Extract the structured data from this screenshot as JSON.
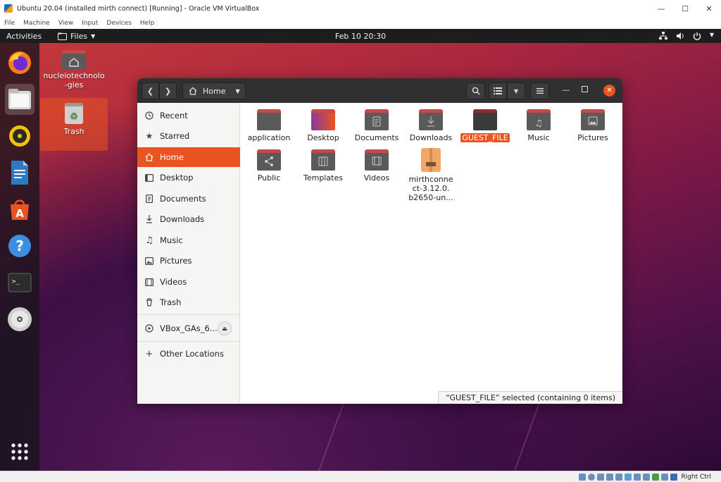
{
  "vbox": {
    "title": "Ubuntu 20.04 (installed mirth connect) [Running] - Oracle VM VirtualBox",
    "menu": [
      "File",
      "Machine",
      "View",
      "Input",
      "Devices",
      "Help"
    ],
    "host_key": "Right Ctrl"
  },
  "topbar": {
    "activities": "Activities",
    "app": "Files",
    "clock": "Feb 10  20:30"
  },
  "desktop": {
    "icons": [
      {
        "label": "nucleiotechnolo-gies",
        "icon": "home-folder-icon"
      },
      {
        "label": "Trash",
        "icon": "trash-icon"
      }
    ]
  },
  "dock": {
    "items": [
      "firefox-icon",
      "files-icon",
      "rhythmbox-icon",
      "libreoffice-writer-icon",
      "ubuntu-software-icon",
      "help-icon",
      "terminal-icon",
      "optical-disc-icon",
      "show-applications-icon"
    ]
  },
  "nautilus": {
    "path_label": "Home",
    "sidebar": [
      {
        "label": "Recent",
        "icon": "clock-icon"
      },
      {
        "label": "Starred",
        "icon": "star-icon"
      },
      {
        "label": "Home",
        "icon": "home-icon"
      },
      {
        "label": "Desktop",
        "icon": "desktop-icon"
      },
      {
        "label": "Documents",
        "icon": "document-icon"
      },
      {
        "label": "Downloads",
        "icon": "download-icon"
      },
      {
        "label": "Music",
        "icon": "music-icon"
      },
      {
        "label": "Pictures",
        "icon": "picture-icon"
      },
      {
        "label": "Videos",
        "icon": "video-icon"
      },
      {
        "label": "Trash",
        "icon": "trash-icon"
      },
      {
        "label": "VBox_GAs_6....",
        "icon": "disc-icon"
      },
      {
        "label": "Other Locations",
        "icon": "plus-icon"
      }
    ],
    "files": [
      {
        "label": "application",
        "icon": "folder-icon"
      },
      {
        "label": "Desktop",
        "icon": "desktop-folder-icon"
      },
      {
        "label": "Documents",
        "icon": "documents-folder-icon"
      },
      {
        "label": "Downloads",
        "icon": "downloads-folder-icon"
      },
      {
        "label": "GUEST_FILE",
        "icon": "folder-icon"
      },
      {
        "label": "Music",
        "icon": "music-folder-icon"
      },
      {
        "label": "Pictures",
        "icon": "pictures-folder-icon"
      },
      {
        "label": "Public",
        "icon": "public-folder-icon"
      },
      {
        "label": "Templates",
        "icon": "templates-folder-icon"
      },
      {
        "label": "Videos",
        "icon": "videos-folder-icon"
      },
      {
        "label": "mirthconnect-3.12.0.b2650-un...",
        "icon": "archive-icon"
      }
    ],
    "mirth_lines": [
      "mirthconne",
      "ct-3.12.0.",
      "b2650-un..."
    ],
    "status": "“GUEST_FILE” selected  (containing 0 items)"
  },
  "colors": {
    "accent": "#e95420",
    "folder_top": "#c44a4a",
    "folder_body": "#4f4f4f",
    "topbar": "#1d1d1d",
    "header": "#303030"
  }
}
